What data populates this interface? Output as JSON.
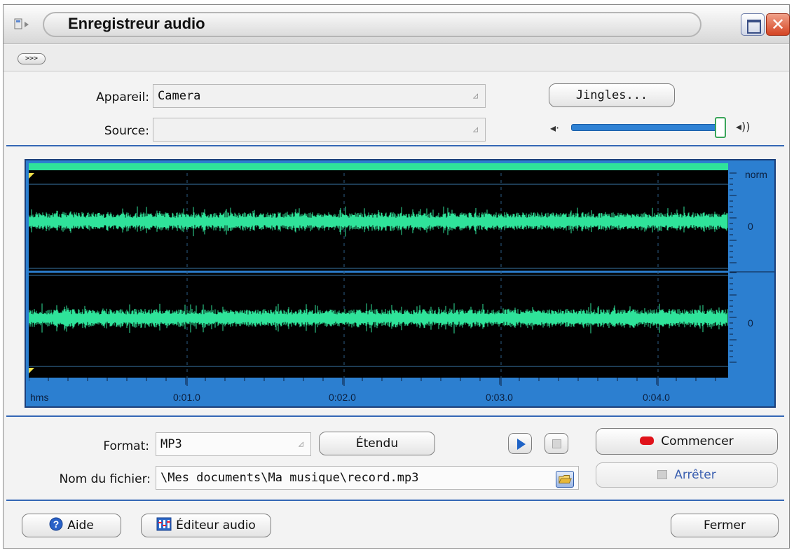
{
  "window": {
    "title": "Enregistreur audio",
    "expand_label": ">>>"
  },
  "device": {
    "label": "Appareil:",
    "value": "Camera"
  },
  "source": {
    "label": "Source:",
    "value": ""
  },
  "jingles_label": "Jingles...",
  "volume": {
    "level": 1.0
  },
  "waveform": {
    "scale_label": "norm",
    "zero_label_top": "0",
    "zero_label_bottom": "0",
    "time_unit": "hms",
    "time_ticks": [
      "0:01.0",
      "0:02.0",
      "0:03.0",
      "0:04.0"
    ]
  },
  "format": {
    "label": "Format:",
    "value": "MP3"
  },
  "extended_label": "Étendu",
  "start_label": "Commencer",
  "stop_label": "Arrêter",
  "filename": {
    "label": "Nom du fichier:",
    "value": "\\Mes documents\\Ma musique\\record.mp3"
  },
  "footer": {
    "help_label": "Aide",
    "editor_label": "Éditeur audio",
    "close_label": "Fermer"
  },
  "colors": {
    "accent": "#2c7fd0",
    "wave": "#2fe39a",
    "record": "#e0121a",
    "separator": "#3467b5"
  }
}
